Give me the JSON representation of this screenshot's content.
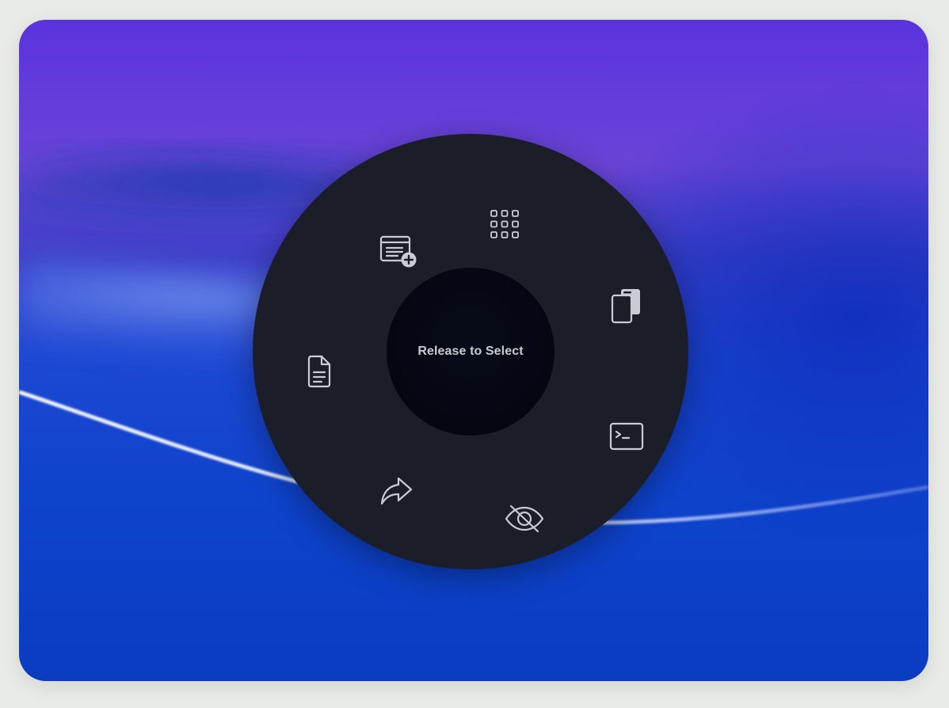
{
  "radial_menu": {
    "center_label": "Release to Select",
    "items": [
      {
        "icon": "app-grid-icon"
      },
      {
        "icon": "copy-icon"
      },
      {
        "icon": "terminal-icon"
      },
      {
        "icon": "eye-slash-icon"
      },
      {
        "icon": "share-arrow-icon"
      },
      {
        "icon": "document-icon"
      },
      {
        "icon": "new-window-icon"
      }
    ]
  },
  "colors": {
    "menu_background": "#1b1e29",
    "hub_background": "#03050f",
    "icon_color": "#c9ccd3",
    "wallpaper_top": "#5a36db",
    "wallpaper_bottom": "#0a3fcb"
  }
}
